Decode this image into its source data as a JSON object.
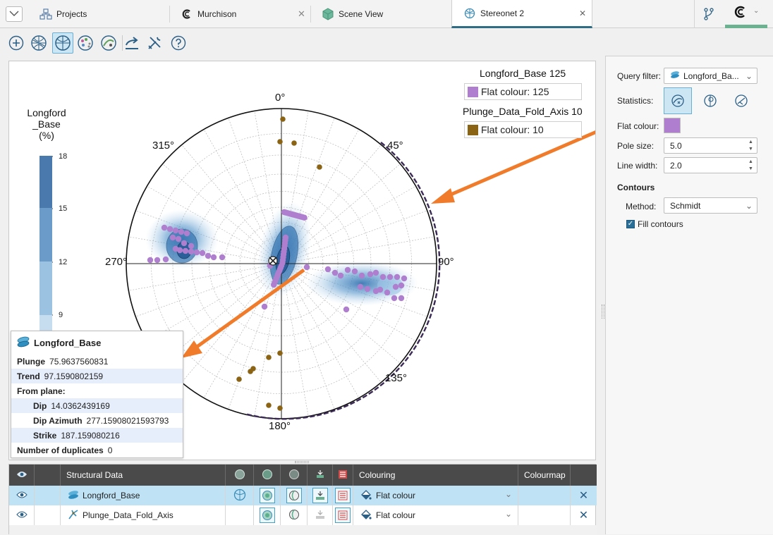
{
  "tabs": {
    "projects": "Projects",
    "murchison": "Murchison",
    "scene_view": "Scene View",
    "stereonet": "Stereonet 2"
  },
  "stereonet": {
    "directions": {
      "n": "0°",
      "ne": "45°",
      "e": "90°",
      "se": "135°",
      "s": "180°",
      "w": "270°",
      "nw": "315°"
    },
    "legend": {
      "longford_title": "Longford_Base 125",
      "longford_entry": "Flat colour: 125",
      "longford_color": "#b07ecf",
      "plunge_title": "Plunge_Data_Fold_Axis 10",
      "plunge_entry": "Flat colour: 10",
      "plunge_color": "#8a6414"
    },
    "scale": {
      "title": "Longford\n_Base\n(%)",
      "ticks": [
        "18",
        "15",
        "12",
        "9"
      ]
    }
  },
  "info": {
    "title": "Longford_Base",
    "plunge_label": "Plunge",
    "plunge_value": "75.9637560831",
    "trend_label": "Trend",
    "trend_value": "97.1590802159",
    "from_plane": "From plane:",
    "dip_label": "Dip",
    "dip_value": "14.0362439169",
    "dip_azimuth_label": "Dip Azimuth",
    "dip_azimuth_value": "277.15908021593793",
    "strike_label": "Strike",
    "strike_value": "187.159080216",
    "duplicates_label": "Number of duplicates",
    "duplicates_value": "0"
  },
  "panel": {
    "query_filter_label": "Query filter:",
    "query_filter_value": "Longford_Ba...",
    "statistics_label": "Statistics:",
    "flat_colour_label": "Flat colour:",
    "pole_size_label": "Pole size:",
    "pole_size_value": "5.0",
    "line_width_label": "Line width:",
    "line_width_value": "2.0",
    "contours_title": "Contours",
    "method_label": "Method:",
    "method_value": "Schmidt",
    "fill_contours_label": "Fill contours",
    "fill_contours_checked": true
  },
  "table": {
    "col_structural": "Structural Data",
    "col_colouring": "Colouring",
    "col_colourmap": "Colourmap",
    "rows": [
      {
        "name": "Longford_Base",
        "colouring": "Flat colour"
      },
      {
        "name": "Plunge_Data_Fold_Axis",
        "colouring": "Flat colour"
      }
    ]
  },
  "colors": {
    "accent": "#2f6d86",
    "arrow": "#f07b2a",
    "selection": "#bfe3f5",
    "pole_purple": "#b07ecf",
    "pole_brown": "#8a6414"
  }
}
